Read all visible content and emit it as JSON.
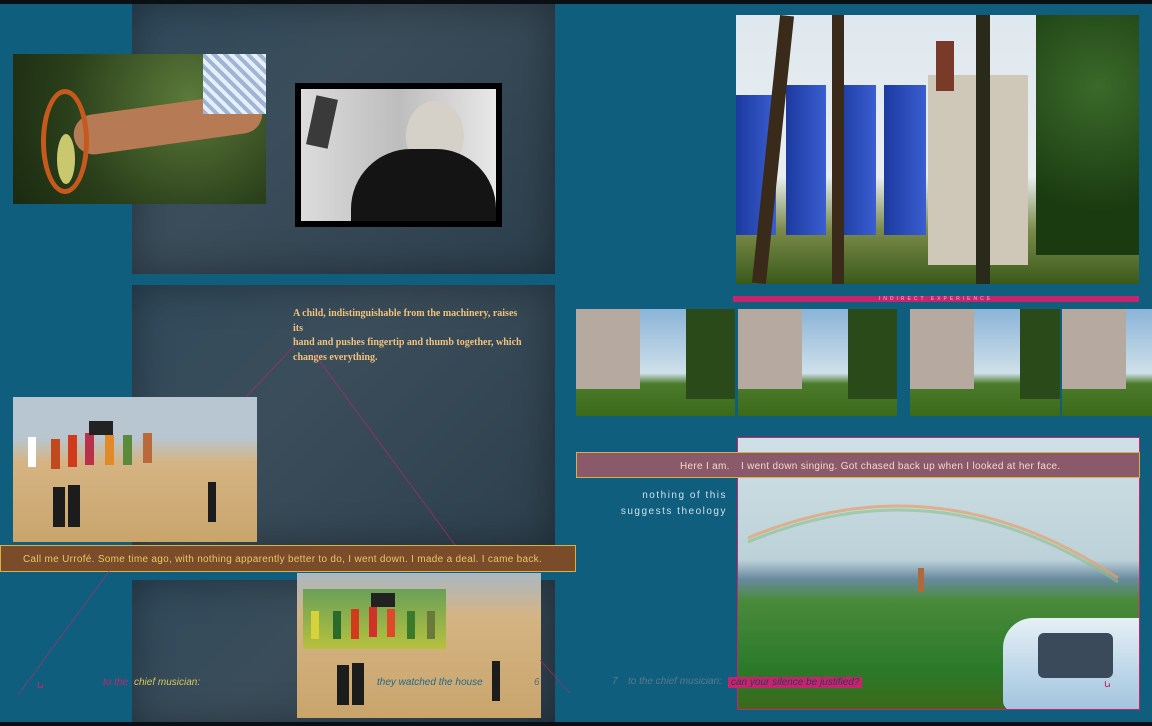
{
  "left_page": {
    "poem_lines": [
      "A child, indistinguishable from the machinery, raises",
      "its",
      "hand and pushes fingertip and thumb together, which",
      "changes everything."
    ],
    "narration_band": "Call me Urrofé. Some time ago, with nothing apparently better to do, I went down. I made a deal. I came back.",
    "footer": {
      "glyph": "ꭎ",
      "prefix": "to the",
      "chief": "chief musician:",
      "caption": "they watched the house",
      "page_number": "6"
    }
  },
  "right_page": {
    "strip_label": "INDIRECT EXPERIENCE",
    "speech_band": {
      "lead": "Here I am.",
      "rest": "I went down singing. Got chased back up when I looked at her face."
    },
    "side_text_lines": [
      "nothing of this",
      "suggests theology"
    ],
    "footer": {
      "page_number": "7",
      "prefix": "to the chief musician:",
      "highlight": "can your silence be justified?",
      "glyph": "ꭎ"
    }
  },
  "colors": {
    "background": "#0f5e7e",
    "magenta": "#c8246e",
    "gold": "#d7b04a",
    "narration_bg": "#7a4c2a",
    "speech_bg": "#8a5a6a"
  }
}
